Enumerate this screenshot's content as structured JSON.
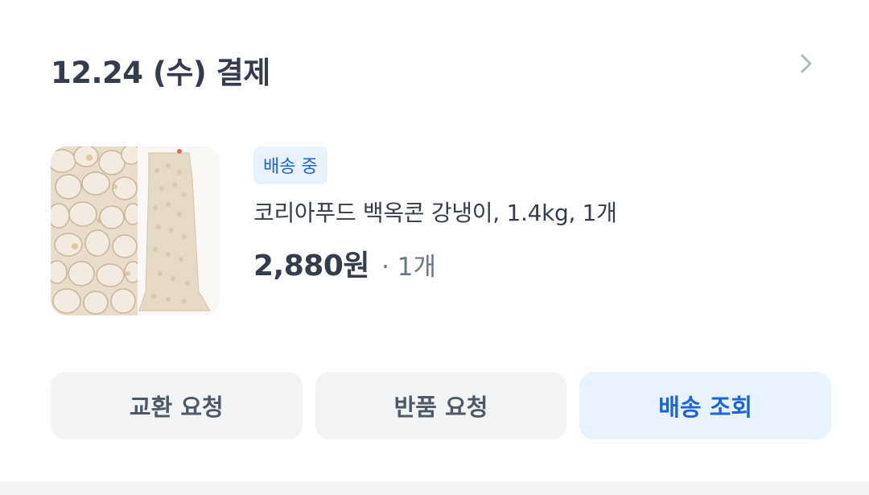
{
  "order": {
    "date_title": "12.24 (수) 결제",
    "status_badge": "배송 중",
    "product_name": "코리아푸드 백옥콘 강냉이, 1.4kg, 1개",
    "price": "2,880원",
    "quantity": "· 1개"
  },
  "icons": {
    "detail": "chevron-right-icon",
    "thumbnail": "product-image"
  },
  "actions": {
    "exchange_label": "교환 요청",
    "return_label": "반품 요청",
    "track_label": "배송 조회"
  },
  "colors": {
    "text_primary": "#333d4b",
    "text_secondary": "#6b7684",
    "accent_blue": "#1b64da",
    "accent_bg": "#e8f3ff",
    "button_bg": "#f2f4f6"
  }
}
